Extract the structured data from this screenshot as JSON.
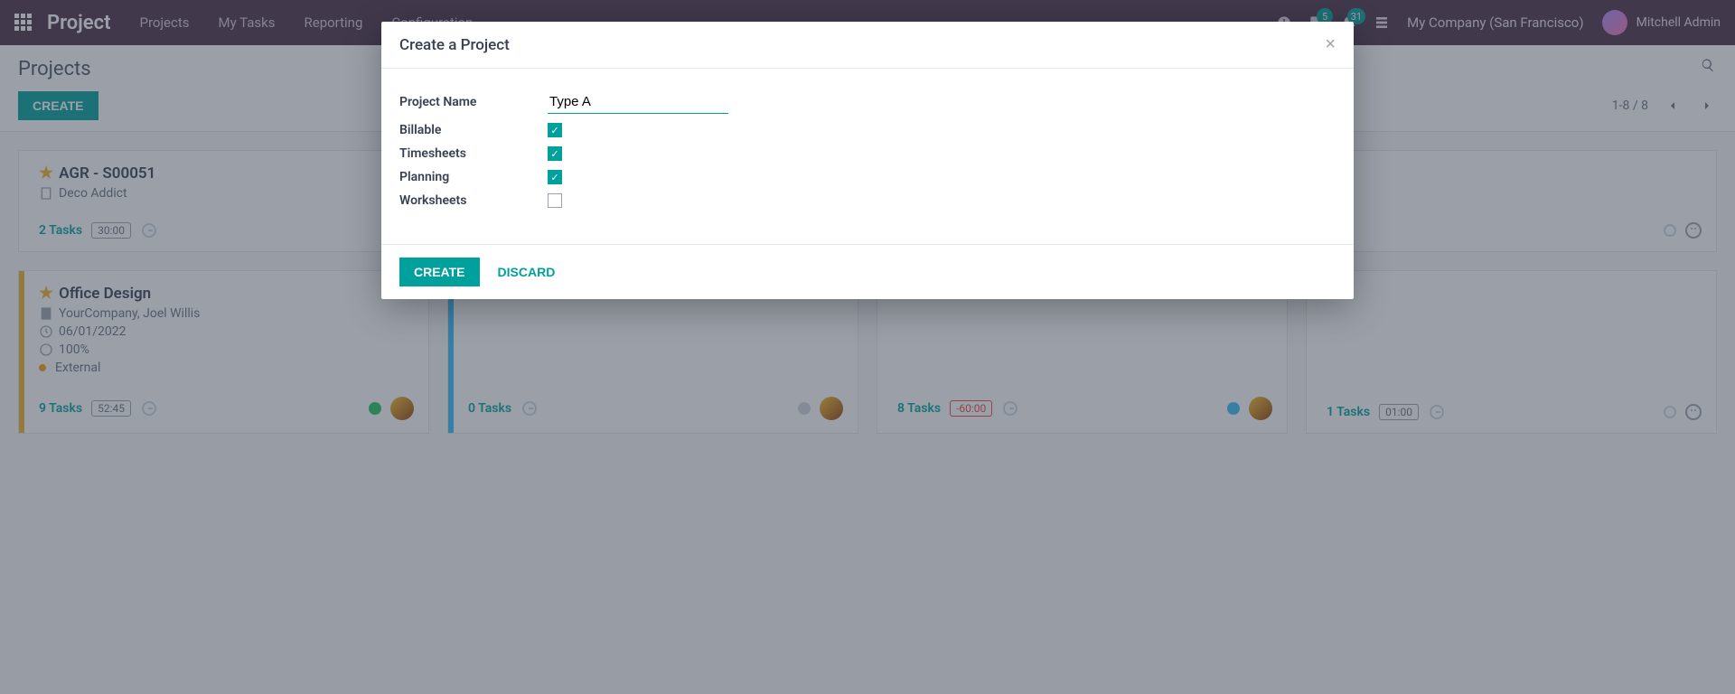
{
  "nav": {
    "brand": "Project",
    "links": [
      "Projects",
      "My Tasks",
      "Reporting",
      "Configuration"
    ],
    "badges": {
      "messages": "5",
      "activities": "31"
    },
    "company": "My Company (San Francisco)",
    "user": "Mitchell Admin"
  },
  "subhead": {
    "title": "Projects",
    "create_label": "CREATE",
    "pager": "1-8 / 8"
  },
  "cards": [
    {
      "edge": "#ffffff",
      "star": true,
      "title": "AGR - S00051",
      "company": "Deco Addict",
      "date": "",
      "progress": "",
      "tag": "",
      "tasks_count": "2",
      "tasks_label": "Tasks",
      "pill": "30:00",
      "pill_class": "",
      "status": "outline",
      "avatar": false,
      "face": true
    },
    {
      "edge": "#f0b429",
      "star": true,
      "title": "Office Design",
      "company": "YourCompany, Joel Willis",
      "date": "06/01/2022",
      "progress": "100%",
      "tag": "External",
      "tasks_count": "9",
      "tasks_label": "Tasks",
      "pill": "52:45",
      "pill_class": "",
      "status": "green",
      "avatar": true,
      "face": false
    },
    {
      "edge": "#38bdf8",
      "star": false,
      "title": "",
      "tasks_count": "0",
      "tasks_label": "Tasks",
      "pill": "",
      "pill_class": "",
      "status": "gray",
      "avatar": true,
      "face": false
    },
    {
      "edge": "#ffffff",
      "star": false,
      "title": "",
      "tasks_count": "8",
      "tasks_label": "Tasks",
      "pill": "-60:00",
      "pill_class": "neg",
      "status": "blue",
      "avatar": true,
      "face": false
    },
    {
      "edge": "#ffffff",
      "star": false,
      "title": "",
      "tasks_count": "1",
      "tasks_label": "Tasks",
      "pill": "01:00",
      "pill_class": "",
      "status": "outline",
      "avatar": false,
      "face": true
    }
  ],
  "modal": {
    "title": "Create a Project",
    "fields": {
      "project_name_label": "Project Name",
      "project_name_value": "Type A",
      "billable_label": "Billable",
      "billable_checked": true,
      "timesheets_label": "Timesheets",
      "timesheets_checked": true,
      "planning_label": "Planning",
      "planning_checked": true,
      "worksheets_label": "Worksheets",
      "worksheets_checked": false
    },
    "create_label": "CREATE",
    "discard_label": "DISCARD"
  }
}
